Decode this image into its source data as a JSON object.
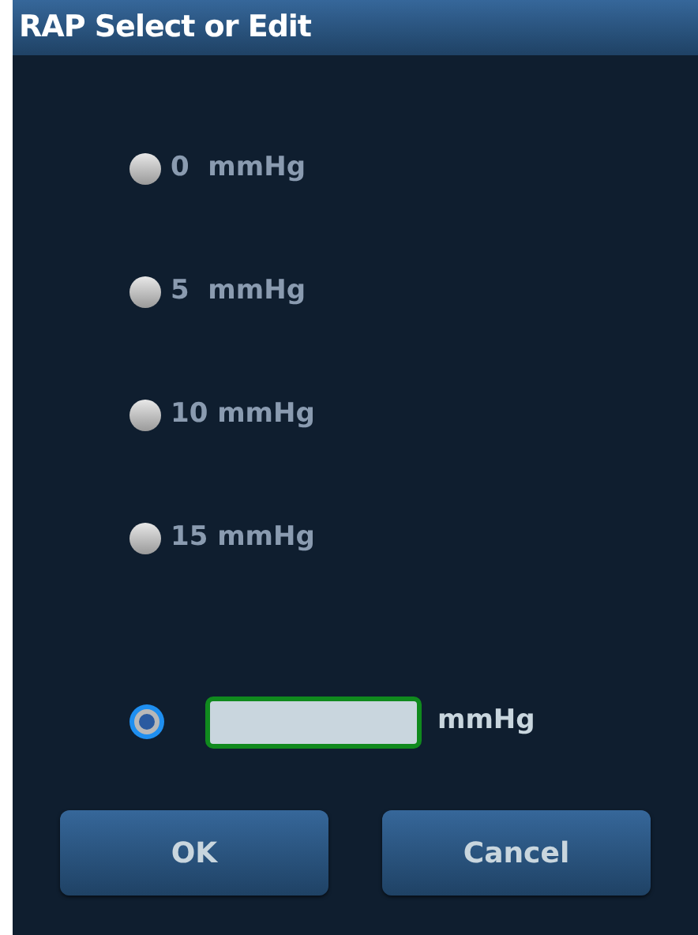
{
  "window": {
    "title": "RAP Select or Edit"
  },
  "options": [
    {
      "kind": "preset",
      "label": "0  mmHg",
      "selected": false
    },
    {
      "kind": "preset",
      "label": "5  mmHg",
      "selected": false
    },
    {
      "kind": "preset",
      "label": "10 mmHg",
      "selected": false
    },
    {
      "kind": "preset",
      "label": "15 mmHg",
      "selected": false
    },
    {
      "kind": "custom",
      "unit": "mmHg",
      "selected": true
    }
  ],
  "buttons": [
    "OK",
    "Cancel"
  ]
}
